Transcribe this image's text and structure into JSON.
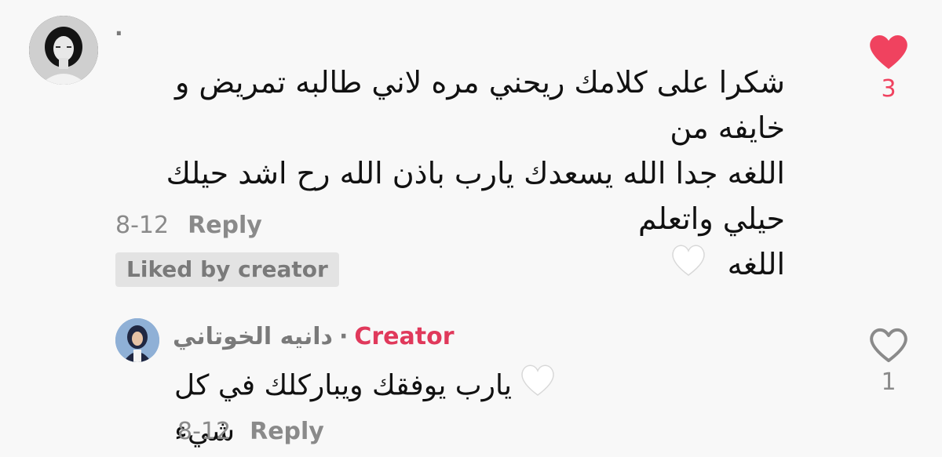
{
  "comment": {
    "username": "·",
    "text_lines": [
      "شكرا على كلامك ريحني مره لاني طالبه تمريض و خايفه من",
      "اللغه جدا الله يسعدك يارب باذن الله رح اشد حيلك حيلي واتعلم",
      "اللغه"
    ],
    "date": "8-12",
    "reply_label": "Reply",
    "liked_badge": "Liked by creator",
    "like_count": "3",
    "like_color": "#f0425f"
  },
  "reply": {
    "username": "دانيه الخوتاني",
    "separator": "·",
    "creator_label": "Creator",
    "text": "يارب يوفقك ويباركلك في كل شيء",
    "date": "8-12",
    "reply_label": "Reply",
    "like_count": "1",
    "creator_color": "#e0395b"
  },
  "icons": {
    "filled_heart": "heart-filled-icon",
    "outline_heart": "heart-outline-icon",
    "white_heart_emoji": "white-heart-emoji"
  }
}
